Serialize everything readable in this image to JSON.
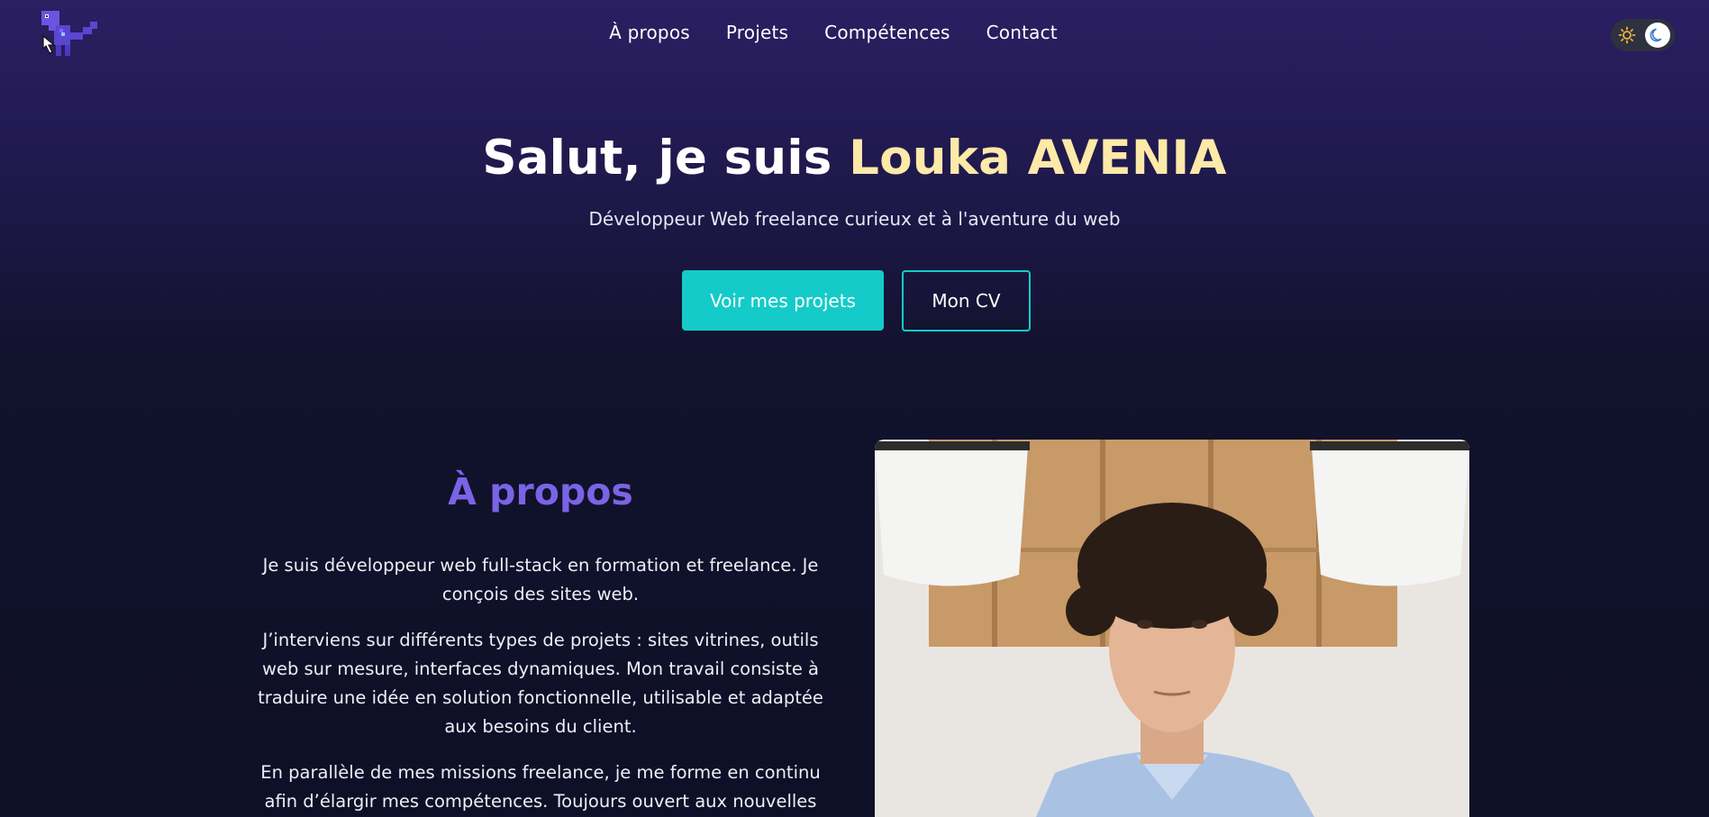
{
  "nav": {
    "logo_icon": "pixel-dinosaur-logo",
    "links": [
      "À propos",
      "Projets",
      "Compétences",
      "Contact"
    ],
    "theme_toggle": {
      "light_icon": "sun-icon",
      "dark_icon": "moon-icon",
      "active": "dark"
    }
  },
  "hero": {
    "title_prefix": "Salut, je suis ",
    "title_name": "Louka AVENIA",
    "subtitle": "Développeur Web freelance curieux et à l'aventure du web",
    "primary_button": "Voir mes projets",
    "secondary_button": "Mon CV"
  },
  "about": {
    "title": "À propos",
    "paragraphs": [
      "Je suis développeur web full-stack en formation et freelance. Je conçois des sites web.",
      "J’interviens sur différents types de projets : sites vitrines, outils web sur mesure, interfaces dynamiques. Mon travail consiste à traduire une idée en solution fonctionnelle, utilisable et adaptée aux besoins du client.",
      "En parallèle de mes missions freelance, je me forme en continu afin d’élargir mes compétences. Toujours ouvert aux nouvelles"
    ]
  },
  "colors": {
    "accent_teal": "#14cbc9",
    "name_highlight": "#fde9a8",
    "about_title": "#7b63e6",
    "bg_top": "#2b1f63",
    "bg_bottom": "#0e1027"
  }
}
